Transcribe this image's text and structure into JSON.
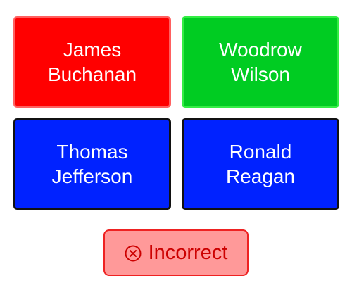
{
  "choices": [
    {
      "label": "James\nBuchanan",
      "fill": "#ff0000",
      "border": "#ff6060"
    },
    {
      "label": "Woodrow\nWilson",
      "fill": "#00cc22",
      "border": "#33ee44"
    },
    {
      "label": "Thomas\nJefferson",
      "fill": "#0022ff",
      "border": "#111111"
    },
    {
      "label": "Ronald\nReagan",
      "fill": "#0022ff",
      "border": "#111111"
    }
  ],
  "result": {
    "icon": "x-circle-icon",
    "label": "Incorrect",
    "fill": "#ff9999",
    "border": "#ee2222",
    "text_color": "#cc0000"
  }
}
